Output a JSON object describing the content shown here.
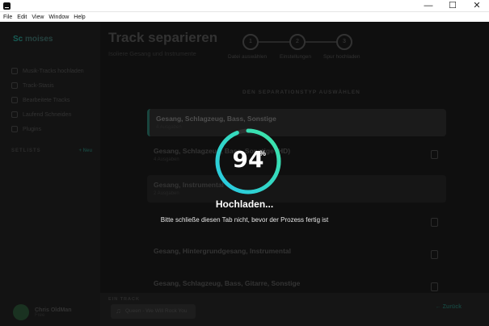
{
  "window": {
    "menu": [
      "File",
      "Edit",
      "View",
      "Window",
      "Help"
    ],
    "controls": {
      "minimize": "—",
      "maximize": "☐",
      "close": "✕"
    }
  },
  "sidebar": {
    "logo_prefix": "Sc",
    "logo_text": "moises",
    "items": [
      {
        "label": "Musik-Tracks hochladen",
        "icon": "upload-icon"
      },
      {
        "label": "Track-Stasis",
        "icon": "music-icon"
      },
      {
        "label": "Bearbeitete Tracks",
        "icon": "list-icon"
      },
      {
        "label": "Laufend Schneiden",
        "icon": "scissors-icon"
      },
      {
        "label": "Plugins",
        "icon": "plugin-icon"
      }
    ],
    "setlists_label": "SETLISTS",
    "new_label": "+ Neu",
    "user": {
      "name": "Chris OldMan",
      "plan": "Free"
    }
  },
  "main": {
    "title": "Track separieren",
    "subtitle": "Isoliere Gesang und Instrumente",
    "steps": [
      {
        "number": "1",
        "label": "Datei auswählen"
      },
      {
        "number": "2",
        "label": "Einstellungen"
      },
      {
        "number": "3",
        "label": "Spur hochladen"
      }
    ],
    "separation_heading": "DEN SEPARATIONSTYP AUSWÄHLEN",
    "options": [
      {
        "title": "Gesang, Schlagzeug, Bass, Sonstige",
        "sub": "4 Ausgaben"
      },
      {
        "title": "Gesang, Schlagzeug, Bass, Sonstige (HD)",
        "sub": "4 Ausgaben"
      },
      {
        "title": "Gesang, Instrumental",
        "sub": "2 Ausgaben"
      },
      {
        "title": "",
        "sub": ""
      },
      {
        "title": "Gesang, Hintergrundgesang, Instrumental",
        "sub": ""
      },
      {
        "title": "Gesang, Schlagzeug, Bass, Gitarre, Sonstige",
        "sub": ""
      }
    ]
  },
  "bottom": {
    "label": "EIN TRACK",
    "track": "Queen - We Will Rock You",
    "back_label": "← Zurück"
  },
  "overlay": {
    "progress_percent": 94,
    "percent_text": "94",
    "percent_sign": "%",
    "status": "Hochladen...",
    "note": "Bitte schließe diesen Tab nicht, bevor der Prozess fertig ist"
  },
  "colors": {
    "ring_start": "#27c8e6",
    "ring_end": "#3ee6a4",
    "ring_track": "#2e2e2e",
    "accent": "#1b6a62"
  }
}
